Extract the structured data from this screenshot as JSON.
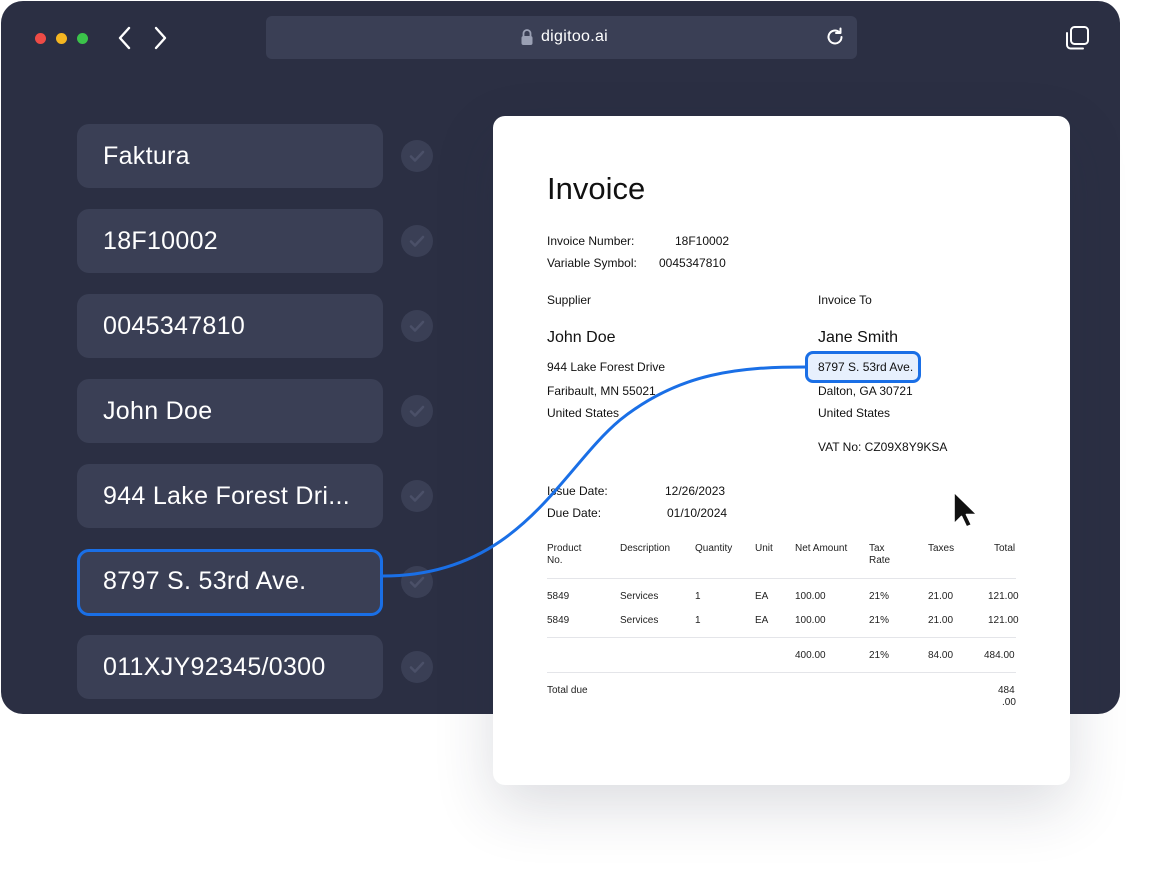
{
  "browser": {
    "url": "digitoo.ai",
    "traffic_lights": {
      "close": "#ee4b46",
      "minimize": "#f5b621",
      "maximize": "#3bc34a"
    }
  },
  "fields": [
    {
      "value": "Faktura"
    },
    {
      "value": "18F10002"
    },
    {
      "value": "0045347810"
    },
    {
      "value": "John Doe"
    },
    {
      "value": "944 Lake Forest Dri..."
    },
    {
      "value": "8797 S. 53rd Ave."
    },
    {
      "value": "011XJY92345/0300"
    }
  ],
  "invoice": {
    "title": "Invoice",
    "invoice_number_label": "Invoice Number:",
    "invoice_number": "18F10002",
    "variable_symbol_label": "Variable Symbol:",
    "variable_symbol": "0045347810",
    "supplier_label": "Supplier",
    "supplier": {
      "name": "John Doe",
      "address1": "944 Lake Forest Drive",
      "address2": "Faribault, MN 55021",
      "country": "United States"
    },
    "invoice_to_label": "Invoice To",
    "customer": {
      "name": "Jane Smith",
      "address1": "8797 S. 53rd Ave.",
      "address2": "Dalton, GA 30721",
      "country": "United States",
      "vat": "VAT No: CZ09X8Y9KSA"
    },
    "issue_date_label": "Issue Date:",
    "issue_date": "12/26/2023",
    "due_date_label": "Due Date:",
    "due_date": "01/10/2024",
    "columns": [
      "Product No.",
      "Description",
      "Quantity",
      "Unit",
      "Net Amount",
      "Tax Rate",
      "Taxes",
      "Total"
    ],
    "rows": [
      {
        "product": "5849",
        "description": "Services",
        "quantity": "1",
        "unit": "EA",
        "net": "100.00",
        "tax_rate": "21%",
        "taxes": "21.00",
        "total": "121.00"
      },
      {
        "product": "5849",
        "description": "Services",
        "quantity": "1",
        "unit": "EA",
        "net": "100.00",
        "tax_rate": "21%",
        "taxes": "21.00",
        "total": "121.00"
      }
    ],
    "summary": {
      "net": "400.00",
      "tax_rate": "21%",
      "taxes": "84.00",
      "total": "484.00"
    },
    "total_due_label": "Total due",
    "total_due_line1": "484",
    "total_due_line2": ".00"
  },
  "accent_color": "#1a6fe6"
}
